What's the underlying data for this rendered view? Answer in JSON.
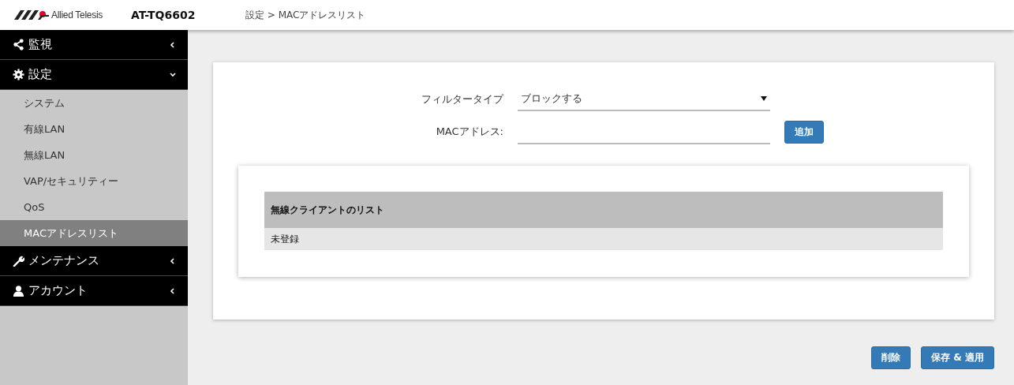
{
  "header": {
    "brand": "Allied Telesis",
    "model": "AT-TQ6602",
    "breadcrumb": "設定 > MACアドレスリスト"
  },
  "sidebar": {
    "items": [
      {
        "label": "監視",
        "expanded": false
      },
      {
        "label": "設定",
        "expanded": true,
        "children": [
          {
            "label": "システム",
            "selected": false
          },
          {
            "label": "有線LAN",
            "selected": false
          },
          {
            "label": "無線LAN",
            "selected": false
          },
          {
            "label": "VAP/セキュリティー",
            "selected": false
          },
          {
            "label": "QoS",
            "selected": false
          },
          {
            "label": "MACアドレスリスト",
            "selected": true
          }
        ]
      },
      {
        "label": "メンテナンス",
        "expanded": false
      },
      {
        "label": "アカウント",
        "expanded": false
      }
    ]
  },
  "form": {
    "filter_label": "フィルタータイプ",
    "filter_value": "ブロックする",
    "mac_label": "MACアドレス:",
    "add_button": "追加"
  },
  "table": {
    "title": "無線クライアントのリスト",
    "rows": [
      "未登録"
    ]
  },
  "buttons": [
    "削除",
    "保存 & 適用"
  ]
}
